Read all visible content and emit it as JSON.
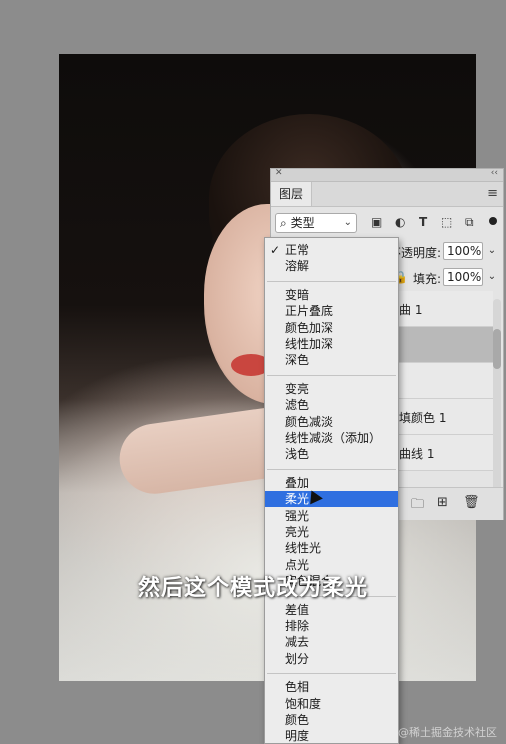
{
  "layers_panel": {
    "tab_label": "图层",
    "filter_kind": "类型",
    "filter_icons": [
      "image-filter-icon",
      "adjustment-filter-icon",
      "text-filter-icon",
      "shape-filter-icon",
      "smart-object-filter-icon"
    ],
    "opacity_label": "不透明度:",
    "opacity_value": "100%",
    "fill_label": "填充:",
    "fill_value": "100%",
    "layers": [
      {
        "name": "曲 1"
      },
      {
        "name": ""
      },
      {
        "name": ""
      },
      {
        "name": "填颜色 1"
      },
      {
        "name": "曲线 1"
      }
    ]
  },
  "blend_menu": {
    "checked": "正常",
    "highlighted": "柔光",
    "groups": [
      [
        "正常",
        "溶解"
      ],
      [
        "变暗",
        "正片叠底",
        "颜色加深",
        "线性加深",
        "深色"
      ],
      [
        "变亮",
        "滤色",
        "颜色减淡",
        "线性减淡（添加）",
        "浅色"
      ],
      [
        "叠加",
        "柔光",
        "强光",
        "亮光",
        "线性光",
        "点光",
        "实色混合"
      ],
      [
        "差值",
        "排除",
        "减去",
        "划分"
      ],
      [
        "色相",
        "饱和度",
        "颜色",
        "明度"
      ]
    ]
  },
  "subtitle": "然后这个模式改为柔光",
  "watermark": "@稀土掘金技术社区",
  "colors": {
    "menu_highlight": "#2f6fe0",
    "panel_bg": "#e4e4e4",
    "workspace_bg": "#8c8c8c"
  }
}
